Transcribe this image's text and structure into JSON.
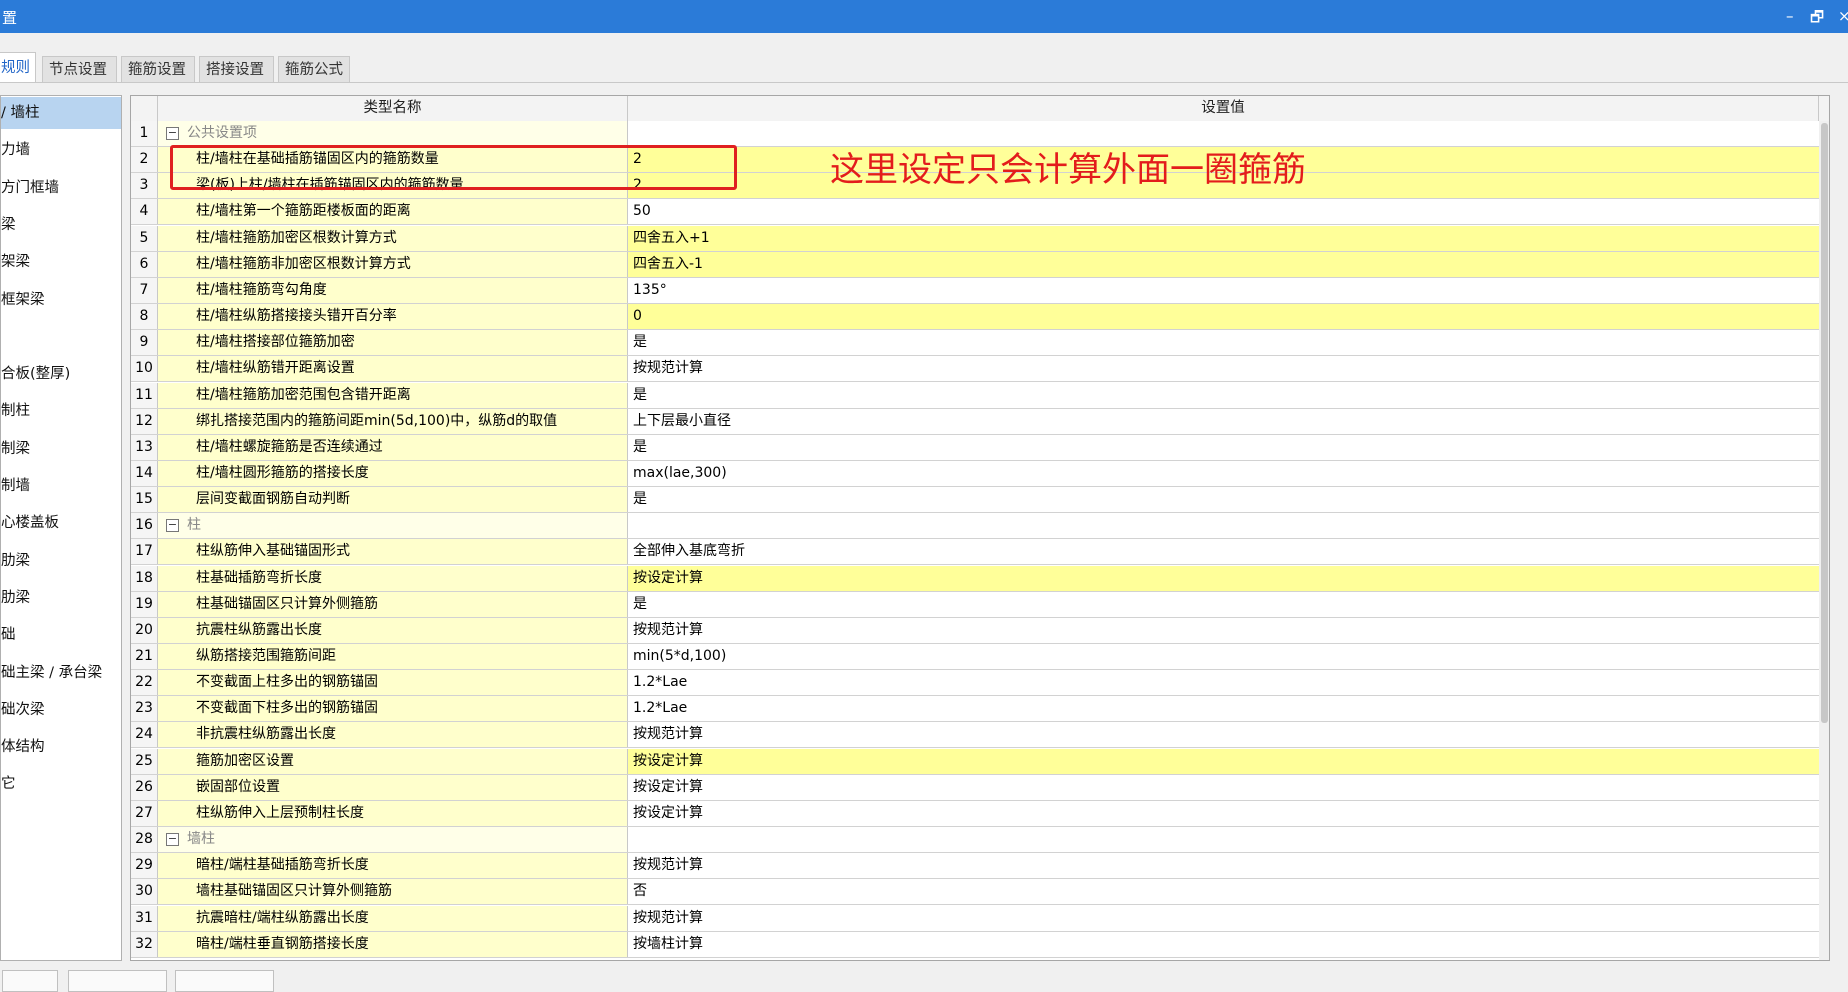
{
  "window": {
    "title": "置",
    "minimize": "–",
    "restore": "🗗",
    "close": "×"
  },
  "tabs": [
    {
      "label": "规则",
      "active": true
    },
    {
      "label": "节点设置",
      "active": false
    },
    {
      "label": "箍筋设置",
      "active": false
    },
    {
      "label": "搭接设置",
      "active": false
    },
    {
      "label": "箍筋公式",
      "active": false
    }
  ],
  "left_items": [
    {
      "label": "/ 墙柱",
      "selected": true
    },
    {
      "label": "力墙",
      "selected": false
    },
    {
      "label": "方门框墙",
      "selected": false
    },
    {
      "label": "梁",
      "selected": false
    },
    {
      "label": "架梁",
      "selected": false
    },
    {
      "label": "框架梁",
      "selected": false
    },
    {
      "label": "",
      "selected": false
    },
    {
      "label": "合板(整厚)",
      "selected": false
    },
    {
      "label": "制柱",
      "selected": false
    },
    {
      "label": "制梁",
      "selected": false
    },
    {
      "label": "制墙",
      "selected": false
    },
    {
      "label": "心楼盖板",
      "selected": false
    },
    {
      "label": "肋梁",
      "selected": false
    },
    {
      "label": "肋梁",
      "selected": false
    },
    {
      "label": "础",
      "selected": false
    },
    {
      "label": "础主梁 / 承台梁",
      "selected": false
    },
    {
      "label": "础次梁",
      "selected": false
    },
    {
      "label": "体结构",
      "selected": false
    },
    {
      "label": "它",
      "selected": false
    }
  ],
  "grid": {
    "col_name": "类型名称",
    "col_value": "设置值",
    "rows": [
      {
        "num": "1",
        "group": true,
        "toggle": "−",
        "name": "公共设置项",
        "value": "",
        "hl": false
      },
      {
        "num": "2",
        "group": false,
        "name": "柱/墙柱在基础插筋锚固区内的箍筋数量",
        "value": "2",
        "hl": true
      },
      {
        "num": "3",
        "group": false,
        "name": "梁(板)上柱/墙柱在插筋锚固区内的箍筋数量",
        "value": "2",
        "hl": true
      },
      {
        "num": "4",
        "group": false,
        "name": "柱/墙柱第一个箍筋距楼板面的距离",
        "value": "50",
        "hl": false
      },
      {
        "num": "5",
        "group": false,
        "name": "柱/墙柱箍筋加密区根数计算方式",
        "value": "四舍五入+1",
        "hl": true
      },
      {
        "num": "6",
        "group": false,
        "name": "柱/墙柱箍筋非加密区根数计算方式",
        "value": "四舍五入-1",
        "hl": true
      },
      {
        "num": "7",
        "group": false,
        "name": "柱/墙柱箍筋弯勾角度",
        "value": "135°",
        "hl": false
      },
      {
        "num": "8",
        "group": false,
        "name": "柱/墙柱纵筋搭接接头错开百分率",
        "value": "0",
        "hl": true
      },
      {
        "num": "9",
        "group": false,
        "name": "柱/墙柱搭接部位箍筋加密",
        "value": "是",
        "hl": false
      },
      {
        "num": "10",
        "group": false,
        "name": "柱/墙柱纵筋错开距离设置",
        "value": "按规范计算",
        "hl": false
      },
      {
        "num": "11",
        "group": false,
        "name": "柱/墙柱箍筋加密范围包含错开距离",
        "value": "是",
        "hl": false
      },
      {
        "num": "12",
        "group": false,
        "name": "绑扎搭接范围内的箍筋间距min(5d,100)中，纵筋d的取值",
        "value": "上下层最小直径",
        "hl": false
      },
      {
        "num": "13",
        "group": false,
        "name": "柱/墙柱螺旋箍筋是否连续通过",
        "value": "是",
        "hl": false
      },
      {
        "num": "14",
        "group": false,
        "name": "柱/墙柱圆形箍筋的搭接长度",
        "value": "max(lae,300)",
        "hl": false
      },
      {
        "num": "15",
        "group": false,
        "name": "层间变截面钢筋自动判断",
        "value": "是",
        "hl": false
      },
      {
        "num": "16",
        "group": true,
        "toggle": "−",
        "name": "柱",
        "value": "",
        "hl": false
      },
      {
        "num": "17",
        "group": false,
        "name": "柱纵筋伸入基础锚固形式",
        "value": "全部伸入基底弯折",
        "hl": false
      },
      {
        "num": "18",
        "group": false,
        "name": "柱基础插筋弯折长度",
        "value": "按设定计算",
        "hl": true
      },
      {
        "num": "19",
        "group": false,
        "name": "柱基础锚固区只计算外侧箍筋",
        "value": "是",
        "hl": false
      },
      {
        "num": "20",
        "group": false,
        "name": "抗震柱纵筋露出长度",
        "value": "按规范计算",
        "hl": false
      },
      {
        "num": "21",
        "group": false,
        "name": "纵筋搭接范围箍筋间距",
        "value": "min(5*d,100)",
        "hl": false
      },
      {
        "num": "22",
        "group": false,
        "name": "不变截面上柱多出的钢筋锚固",
        "value": "1.2*Lae",
        "hl": false
      },
      {
        "num": "23",
        "group": false,
        "name": "不变截面下柱多出的钢筋锚固",
        "value": "1.2*Lae",
        "hl": false
      },
      {
        "num": "24",
        "group": false,
        "name": "非抗震柱纵筋露出长度",
        "value": "按规范计算",
        "hl": false
      },
      {
        "num": "25",
        "group": false,
        "name": "箍筋加密区设置",
        "value": "按设定计算",
        "hl": true
      },
      {
        "num": "26",
        "group": false,
        "name": "嵌固部位设置",
        "value": "按设定计算",
        "hl": false
      },
      {
        "num": "27",
        "group": false,
        "name": "柱纵筋伸入上层预制柱长度",
        "value": "按设定计算",
        "hl": false
      },
      {
        "num": "28",
        "group": true,
        "toggle": "−",
        "name": "墙柱",
        "value": "",
        "hl": false
      },
      {
        "num": "29",
        "group": false,
        "name": "暗柱/端柱基础插筋弯折长度",
        "value": "按规范计算",
        "hl": false
      },
      {
        "num": "30",
        "group": false,
        "name": "墙柱基础锚固区只计算外侧箍筋",
        "value": "否",
        "hl": false
      },
      {
        "num": "31",
        "group": false,
        "name": "抗震暗柱/端柱纵筋露出长度",
        "value": "按规范计算",
        "hl": false
      },
      {
        "num": "32",
        "group": false,
        "name": "暗柱/端柱垂直钢筋搭接长度",
        "value": "按墙柱计算",
        "hl": false
      }
    ]
  },
  "annotation": "这里设定只会计算外面一圈箍筋",
  "colors": {
    "titlebar": "#2b7bd8",
    "highlight_row": "#ffff99",
    "name_column": "#ffffcc",
    "annotation": "#e31c1c",
    "selected_item": "#b8d4f0"
  }
}
